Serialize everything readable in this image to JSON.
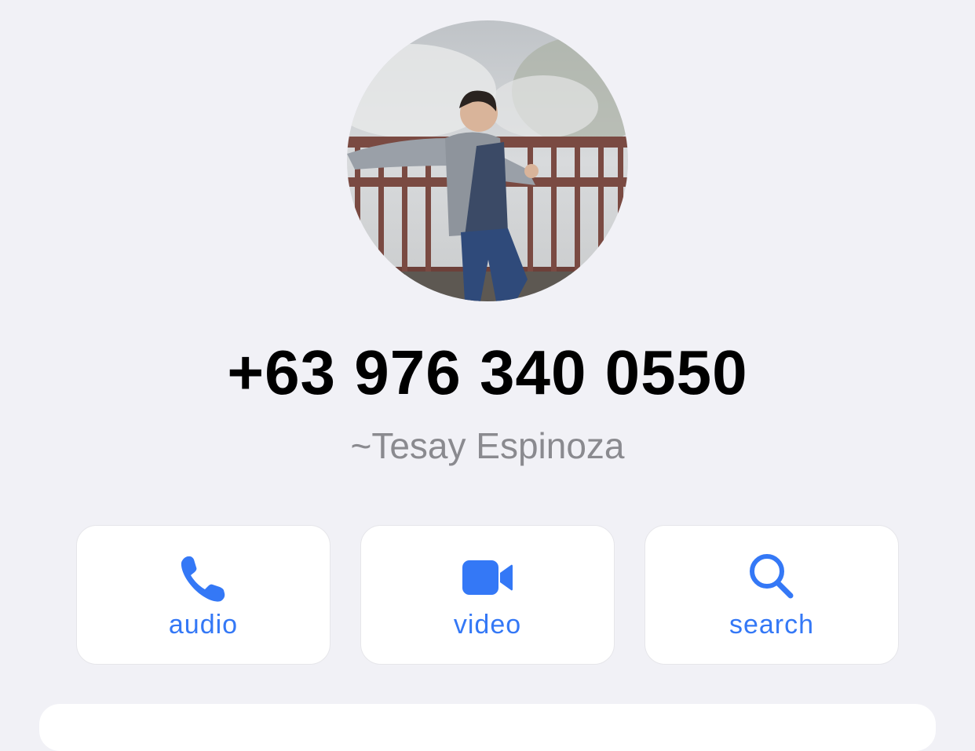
{
  "contact": {
    "phone_number": "+63 976 340 0550",
    "display_name": "~Tesay Espinoza"
  },
  "actions": [
    {
      "label": "audio",
      "icon": "phone-icon"
    },
    {
      "label": "video",
      "icon": "video-camera-icon"
    },
    {
      "label": "search",
      "icon": "search-icon"
    }
  ],
  "colors": {
    "background": "#f1f1f6",
    "accent": "#3478f6",
    "secondary_text": "#8a8a8f"
  }
}
